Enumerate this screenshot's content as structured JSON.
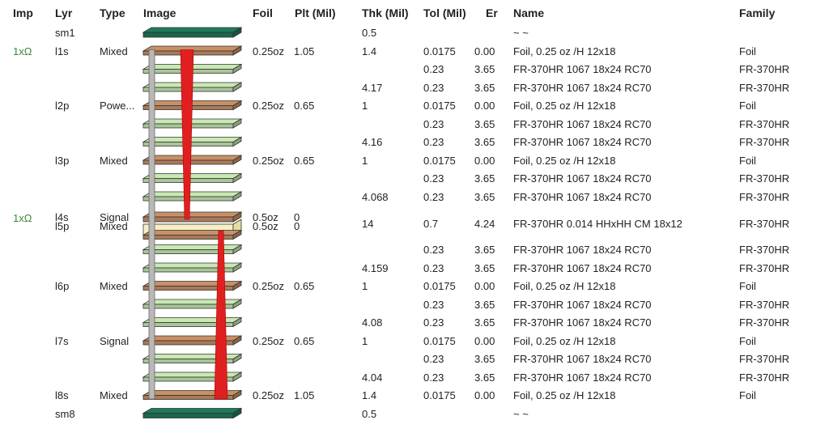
{
  "headers": {
    "imp": "Imp",
    "lyr": "Lyr",
    "type": "Type",
    "image": "Image",
    "foil": "Foil",
    "plt": "Plt (Mil)",
    "thk": "Thk (Mil)",
    "tol": "Tol (Mil)",
    "er": "Er",
    "name": "Name",
    "family": "Family"
  },
  "colors": {
    "soldermask": "#1e7a58",
    "foil": "#c89068",
    "prepreg": "#c9e8b4",
    "core": "#f6efc6",
    "via": "#e02020",
    "drill": "#b8b8b8",
    "impedance": "#3a8a3a"
  },
  "rows": [
    {
      "kind": "mask",
      "imp": "",
      "lyr": "sm1",
      "type": "",
      "foil": "",
      "plt": "",
      "thk": "0.5",
      "tol": "",
      "er": "",
      "name": "~ ~",
      "family": ""
    },
    {
      "kind": "foil",
      "imp": "1xΩ",
      "lyr": "l1s",
      "type": "Mixed",
      "foil": "0.25oz",
      "plt": "1.05",
      "thk": "1.4",
      "tol": "0.0175",
      "er": "0.00",
      "name": "Foil, 0.25 oz /H 12x18",
      "family": "Foil"
    },
    {
      "kind": "pp",
      "imp": "",
      "lyr": "",
      "type": "",
      "foil": "",
      "plt": "",
      "thk": "",
      "tol": "0.23",
      "er": "3.65",
      "name": "FR-370HR 1067 18x24 RC70",
      "family": "FR-370HR"
    },
    {
      "kind": "pp",
      "imp": "",
      "lyr": "",
      "type": "",
      "foil": "",
      "plt": "",
      "thk": "4.17",
      "tol": "0.23",
      "er": "3.65",
      "name": "FR-370HR 1067 18x24 RC70",
      "family": "FR-370HR"
    },
    {
      "kind": "foil",
      "imp": "",
      "lyr": "l2p",
      "type": "Powe...",
      "foil": "0.25oz",
      "plt": "0.65",
      "thk": "1",
      "tol": "0.0175",
      "er": "0.00",
      "name": "Foil, 0.25 oz /H 12x18",
      "family": "Foil"
    },
    {
      "kind": "pp",
      "imp": "",
      "lyr": "",
      "type": "",
      "foil": "",
      "plt": "",
      "thk": "",
      "tol": "0.23",
      "er": "3.65",
      "name": "FR-370HR 1067 18x24 RC70",
      "family": "FR-370HR"
    },
    {
      "kind": "pp",
      "imp": "",
      "lyr": "",
      "type": "",
      "foil": "",
      "plt": "",
      "thk": "4.16",
      "tol": "0.23",
      "er": "3.65",
      "name": "FR-370HR 1067 18x24 RC70",
      "family": "FR-370HR"
    },
    {
      "kind": "foil",
      "imp": "",
      "lyr": "l3p",
      "type": "Mixed",
      "foil": "0.25oz",
      "plt": "0.65",
      "thk": "1",
      "tol": "0.0175",
      "er": "0.00",
      "name": "Foil, 0.25 oz /H 12x18",
      "family": "Foil"
    },
    {
      "kind": "pp",
      "imp": "",
      "lyr": "",
      "type": "",
      "foil": "",
      "plt": "",
      "thk": "",
      "tol": "0.23",
      "er": "3.65",
      "name": "FR-370HR 1067 18x24 RC70",
      "family": "FR-370HR"
    },
    {
      "kind": "pp",
      "imp": "",
      "lyr": "",
      "type": "",
      "foil": "",
      "plt": "",
      "thk": "4.068",
      "tol": "0.23",
      "er": "3.65",
      "name": "FR-370HR 1067 18x24 RC70",
      "family": "FR-370HR"
    },
    {
      "kind": "core",
      "imp": "1xΩ",
      "lyr": "l4s",
      "type": "Signal",
      "foil": "0.5oz",
      "plt": "0",
      "lyr2": "l5p",
      "type2": "Mixed",
      "foil2": "0.5oz",
      "plt2": "0",
      "thk": "14",
      "tol": "0.7",
      "er": "4.24",
      "name": "FR-370HR 0.014 HHxHH CM 18x12",
      "family": "FR-370HR"
    },
    {
      "kind": "pp",
      "imp": "",
      "lyr": "",
      "type": "",
      "foil": "",
      "plt": "",
      "thk": "",
      "tol": "0.23",
      "er": "3.65",
      "name": "FR-370HR 1067 18x24 RC70",
      "family": "FR-370HR"
    },
    {
      "kind": "pp",
      "imp": "",
      "lyr": "",
      "type": "",
      "foil": "",
      "plt": "",
      "thk": "4.159",
      "tol": "0.23",
      "er": "3.65",
      "name": "FR-370HR 1067 18x24 RC70",
      "family": "FR-370HR"
    },
    {
      "kind": "foil",
      "imp": "",
      "lyr": "l6p",
      "type": "Mixed",
      "foil": "0.25oz",
      "plt": "0.65",
      "thk": "1",
      "tol": "0.0175",
      "er": "0.00",
      "name": "Foil, 0.25 oz /H 12x18",
      "family": "Foil"
    },
    {
      "kind": "pp",
      "imp": "",
      "lyr": "",
      "type": "",
      "foil": "",
      "plt": "",
      "thk": "",
      "tol": "0.23",
      "er": "3.65",
      "name": "FR-370HR 1067 18x24 RC70",
      "family": "FR-370HR"
    },
    {
      "kind": "pp",
      "imp": "",
      "lyr": "",
      "type": "",
      "foil": "",
      "plt": "",
      "thk": "4.08",
      "tol": "0.23",
      "er": "3.65",
      "name": "FR-370HR 1067 18x24 RC70",
      "family": "FR-370HR"
    },
    {
      "kind": "foil",
      "imp": "",
      "lyr": "l7s",
      "type": "Signal",
      "foil": "0.25oz",
      "plt": "0.65",
      "thk": "1",
      "tol": "0.0175",
      "er": "0.00",
      "name": "Foil, 0.25 oz /H 12x18",
      "family": "Foil"
    },
    {
      "kind": "pp",
      "imp": "",
      "lyr": "",
      "type": "",
      "foil": "",
      "plt": "",
      "thk": "",
      "tol": "0.23",
      "er": "3.65",
      "name": "FR-370HR 1067 18x24 RC70",
      "family": "FR-370HR"
    },
    {
      "kind": "pp",
      "imp": "",
      "lyr": "",
      "type": "",
      "foil": "",
      "plt": "",
      "thk": "4.04",
      "tol": "0.23",
      "er": "3.65",
      "name": "FR-370HR 1067 18x24 RC70",
      "family": "FR-370HR"
    },
    {
      "kind": "foil",
      "imp": "",
      "lyr": "l8s",
      "type": "Mixed",
      "foil": "0.25oz",
      "plt": "1.05",
      "thk": "1.4",
      "tol": "0.0175",
      "er": "0.00",
      "name": "Foil, 0.25 oz /H 12x18",
      "family": "Foil"
    },
    {
      "kind": "mask",
      "imp": "",
      "lyr": "sm8",
      "type": "",
      "foil": "",
      "plt": "",
      "thk": "0.5",
      "tol": "",
      "er": "",
      "name": "~ ~",
      "family": ""
    }
  ]
}
